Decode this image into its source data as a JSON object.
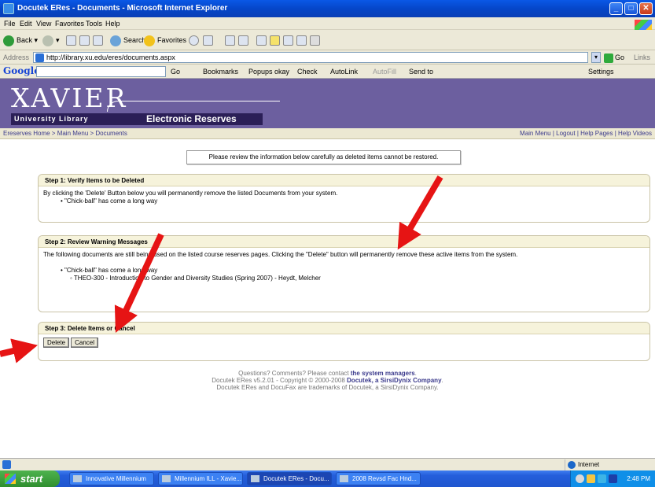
{
  "window": {
    "title": "Docutek ERes - Documents - Microsoft Internet Explorer",
    "minimize_glyph": "_",
    "maximize_glyph": "□",
    "close_glyph": "✕"
  },
  "menu": [
    "File",
    "Edit",
    "View",
    "Favorites",
    "Tools",
    "Help"
  ],
  "toolbar": {
    "back": "Back",
    "search": "Search",
    "favorites": "Favorites"
  },
  "address": {
    "label": "Address",
    "url": "http://library.xu.edu/eres/documents.aspx",
    "go": "Go",
    "links": "Links"
  },
  "google_bar": {
    "logo": "Google",
    "go": "Go",
    "bookmarks": "Bookmarks",
    "popups": "Popups okay",
    "check": "Check",
    "autolink": "AutoLink",
    "autofill": "AutoFill",
    "send_to": "Send to",
    "settings": "Settings"
  },
  "site": {
    "logo_main": "XAVIER",
    "logo_sub": "University Library",
    "logo_product": "Electronic Reserves",
    "breadcrumb": "Ereserves Home > Main Menu > Documents",
    "top_links": "Main Menu | Logout | Help Pages | Help Videos"
  },
  "content": {
    "warning": "Please review the information below carefully as deleted items cannot be restored.",
    "step1": {
      "title": "Step 1: Verify Items to be Deleted",
      "text": "By clicking the 'Delete' Button below you will permanently remove the listed Documents from your system.",
      "item": "\"Chick-ball\" has come a long way"
    },
    "step2": {
      "title": "Step 2: Review Warning Messages",
      "text": "The following documents are still being used on the listed course reserves pages. Clicking the \"Delete\" button will permanently remove these active items from the system.",
      "item": "\"Chick-ball\" has come a long way",
      "subitem": "THEO-300 - Introduction to Gender and Diversity Studies (Spring 2007) - Heydt, Melcher"
    },
    "step3": {
      "title": "Step 3: Delete Items or Cancel",
      "delete": "Delete",
      "cancel": "Cancel"
    }
  },
  "footer": {
    "line1_prefix": "Questions? Comments? Please contact",
    "line1_link": "the system managers",
    "line2_prefix": "Docutek ERes v5.2.01 - Copyright © 2000-2008",
    "line2_link": "Docutek, a SirsiDynix Company",
    "line3": "Docutek ERes and DocuFax are trademarks of Docutek, a SirsiDynix Company."
  },
  "status": {
    "zone": "Internet"
  },
  "taskbar": {
    "start": "start",
    "tasks": [
      "Innovative Millennium",
      "Millennium ILL - Xavie...",
      "Docutek ERes - Docu...",
      "2008 Revsd Fac Hnd..."
    ],
    "clock": "2:48 PM"
  },
  "colors": {
    "header_purple": "#6c5f9f",
    "header_dark": "#2b1f57",
    "arrow_red": "#e61414",
    "panel_header": "#f6f3db"
  }
}
